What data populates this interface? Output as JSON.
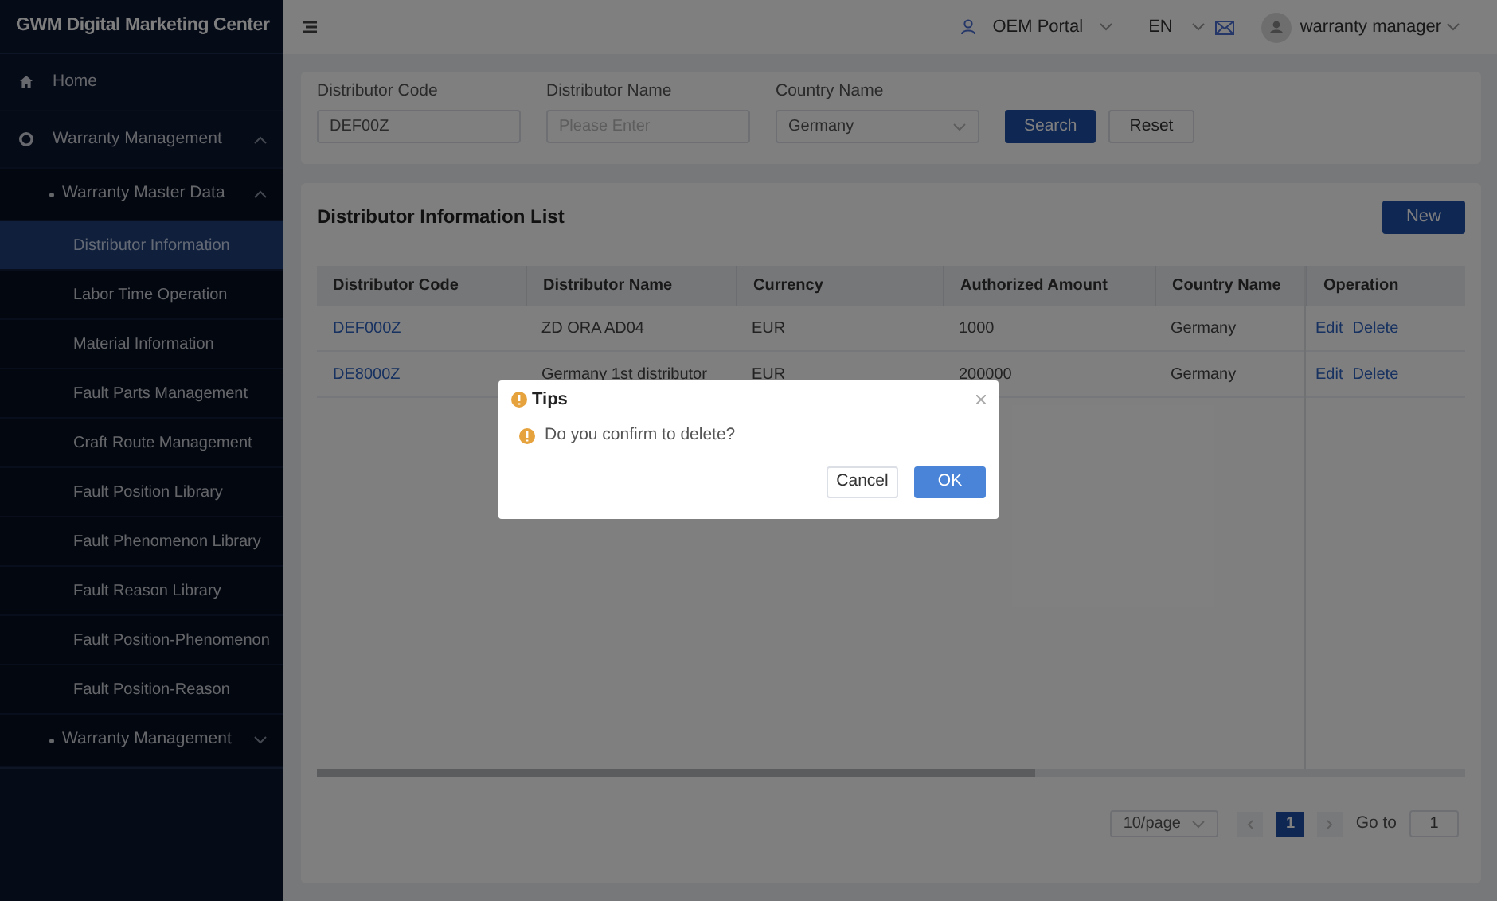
{
  "app_title": "GWM Digital Marketing Center",
  "sidebar": {
    "items": [
      {
        "label": "Home",
        "selected": false
      },
      {
        "label": "Warranty Management",
        "selected": false,
        "expanded": true,
        "children": [
          {
            "label": "Warranty Master Data",
            "selected": false,
            "expanded": true,
            "children": [
              {
                "label": "Distributor Information",
                "selected": true
              },
              {
                "label": "Labor Time Operation",
                "selected": false
              },
              {
                "label": "Material Information",
                "selected": false
              },
              {
                "label": "Fault Parts Management",
                "selected": false
              },
              {
                "label": "Craft Route Management",
                "selected": false
              },
              {
                "label": "Fault Position Library",
                "selected": false
              },
              {
                "label": "Fault Phenomenon Library",
                "selected": false
              },
              {
                "label": "Fault Reason Library",
                "selected": false
              },
              {
                "label": "Fault Position-Phenomenon",
                "selected": false
              },
              {
                "label": "Fault Position-Reason",
                "selected": false
              }
            ]
          },
          {
            "label": "Warranty Management",
            "selected": false,
            "expanded": false
          }
        ]
      }
    ]
  },
  "header": {
    "portal": "OEM Portal",
    "language": "EN",
    "user": "warranty manager"
  },
  "filters": [
    {
      "kind": "input",
      "label": "Distributor Code",
      "value": "DEF00Z"
    },
    {
      "kind": "input",
      "label": "Distributor Name",
      "placeholder": "Please Enter"
    },
    {
      "kind": "select",
      "label": "Country Name",
      "value": "Germany"
    }
  ],
  "filter_buttons": [
    {
      "label": "Search",
      "primary": true
    },
    {
      "label": "Reset",
      "primary": false
    }
  ],
  "list": {
    "title": "Distributor Information List",
    "new_button": "New"
  },
  "table": {
    "columns": [
      "Distributor Code",
      "Distributor Name",
      "Currency",
      "Authorized Amount",
      "Country Name",
      "Operation"
    ],
    "rows": [
      {
        "cells": [
          "DEF000Z",
          "ZD ORA AD04",
          "EUR",
          "1000",
          "Germany"
        ],
        "actions": [
          "Edit",
          "Delete"
        ]
      },
      {
        "cells": [
          "DE8000Z",
          "Germany 1st distributor",
          "EUR",
          "200000",
          "Germany"
        ],
        "actions": [
          "Edit",
          "Delete"
        ]
      }
    ]
  },
  "pagination": {
    "page_size": "10/page",
    "pages": [
      {
        "label": "1",
        "selected": true
      }
    ],
    "goto_label": "Go to",
    "goto_value": "1"
  },
  "dialog": {
    "title": "Tips",
    "message": "Do you confirm to delete?",
    "buttons": [
      {
        "label": "Cancel",
        "primary": false
      },
      {
        "label": "OK",
        "primary": true
      }
    ]
  }
}
